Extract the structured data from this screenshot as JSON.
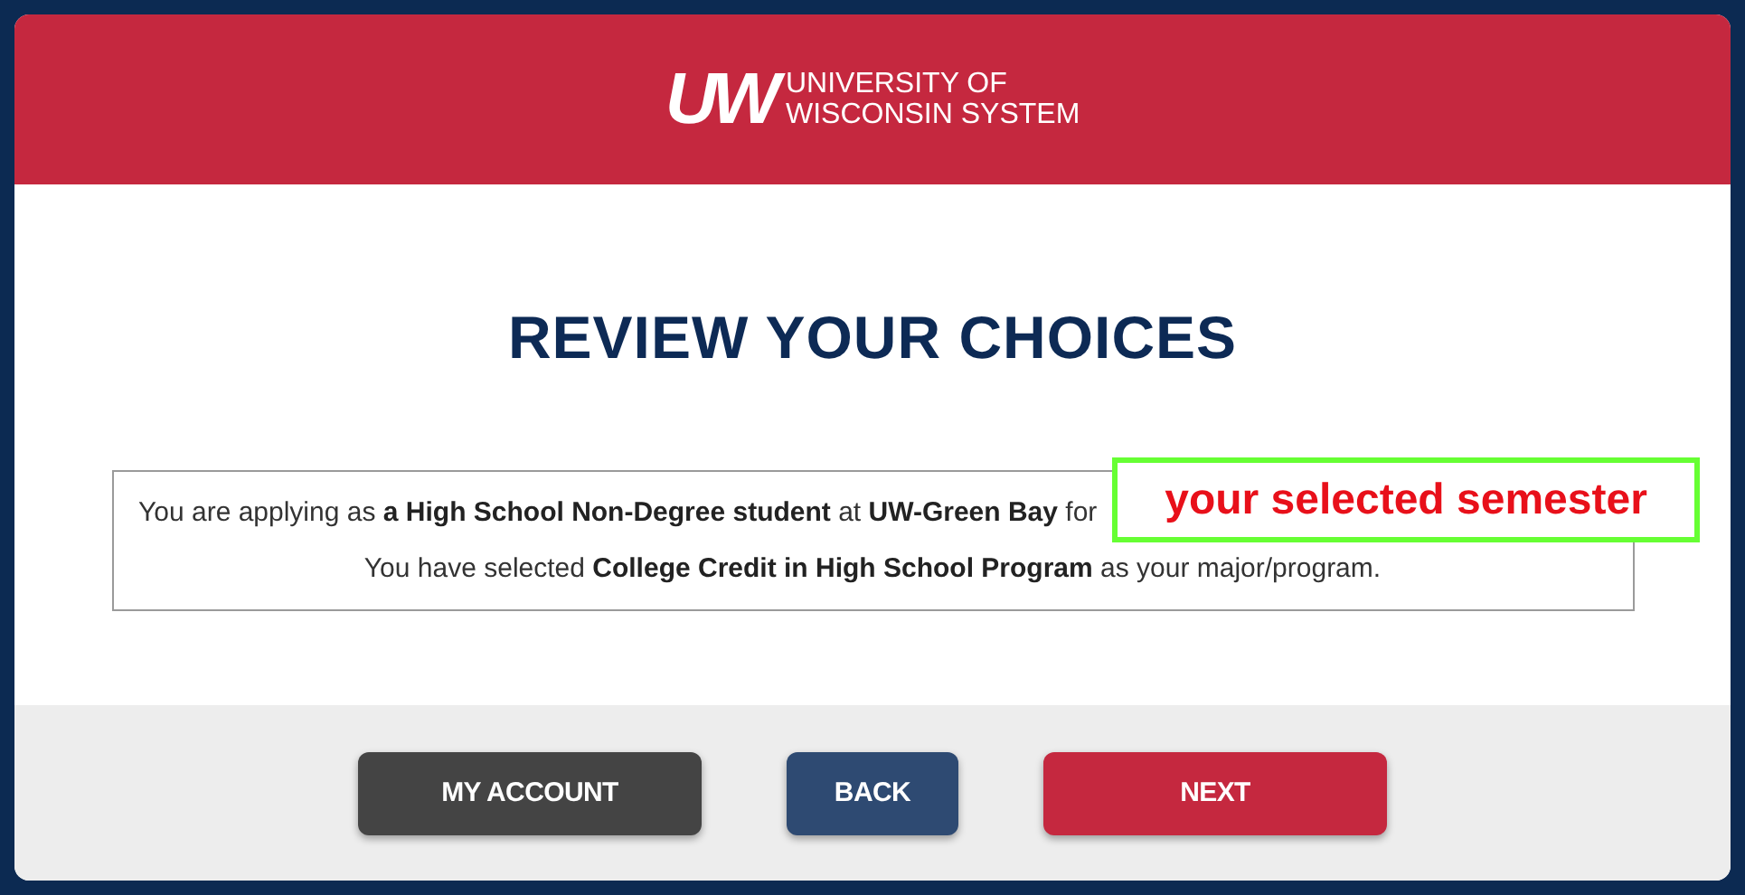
{
  "header": {
    "logo_mark": "UW",
    "logo_lines": [
      "UNIVERSITY OF",
      "WISCONSIN SYSTEM"
    ]
  },
  "title": "REVIEW YOUR CHOICES",
  "summary": {
    "lines": [
      {
        "text": "You are applying as **a High School Non-Degree student** at **UW-Green Bay** for"
      },
      {
        "text": "You have selected **College Credit in High School Program** as your major/program."
      }
    ]
  },
  "callout": {
    "text": "your selected semester"
  },
  "buttons": [
    {
      "label": "MY ACCOUNT",
      "kind": "dark"
    },
    {
      "label": "BACK",
      "kind": "blue"
    },
    {
      "label": "NEXT",
      "kind": "red"
    }
  ]
}
